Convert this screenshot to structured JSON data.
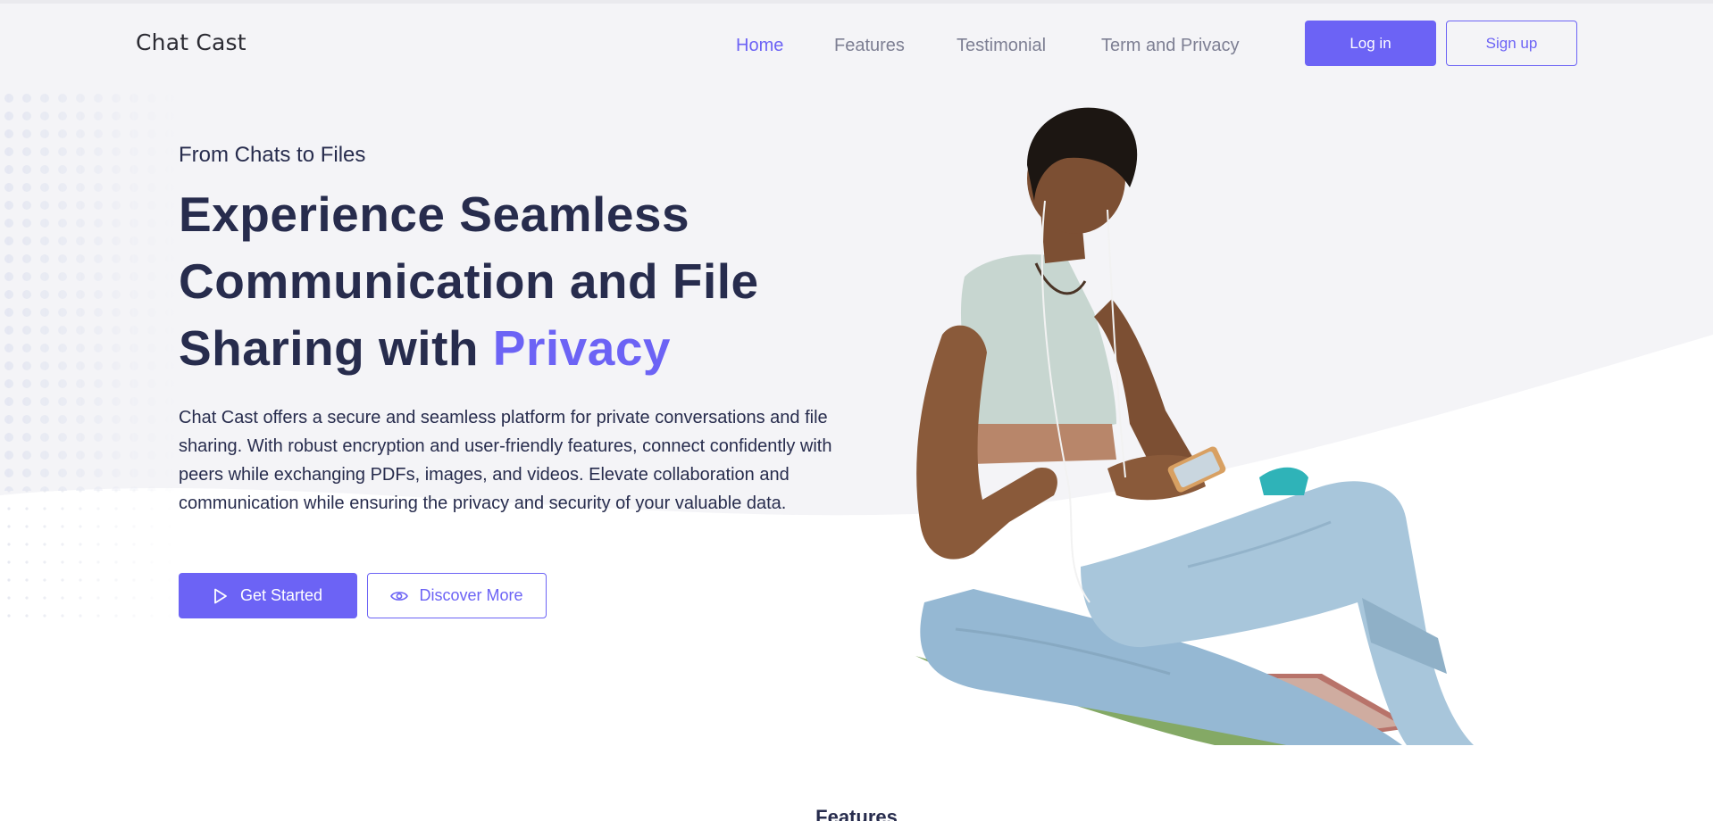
{
  "brand": {
    "name": "Chat Cast",
    "accent": "#6c63f5",
    "text": "#272c4d"
  },
  "nav": {
    "links": [
      {
        "label": "Home",
        "active": true
      },
      {
        "label": "Features",
        "active": false
      },
      {
        "label": "Testimonial",
        "active": false
      },
      {
        "label": "Term and Privacy",
        "active": false
      }
    ],
    "login_label": "Log in",
    "signup_label": "Sign up"
  },
  "hero": {
    "eyebrow": "From Chats to Files",
    "headline_main": "Experience Seamless Communication and File Sharing with ",
    "headline_accent": "Privacy",
    "description": "Chat Cast offers a secure and seamless platform for private conversations and file sharing. With robust encryption and user-friendly features, connect confidently with peers while exchanging PDFs, images, and videos. Elevate collaboration and communication while ensuring the privacy and security of your valuable data.",
    "primary_button": {
      "label": "Get Started",
      "icon": "play-icon"
    },
    "secondary_button": {
      "label": "Discover More",
      "icon": "eye-icon"
    },
    "image": "woman-using-phone-illustration"
  },
  "features_section": {
    "title": "Features"
  }
}
